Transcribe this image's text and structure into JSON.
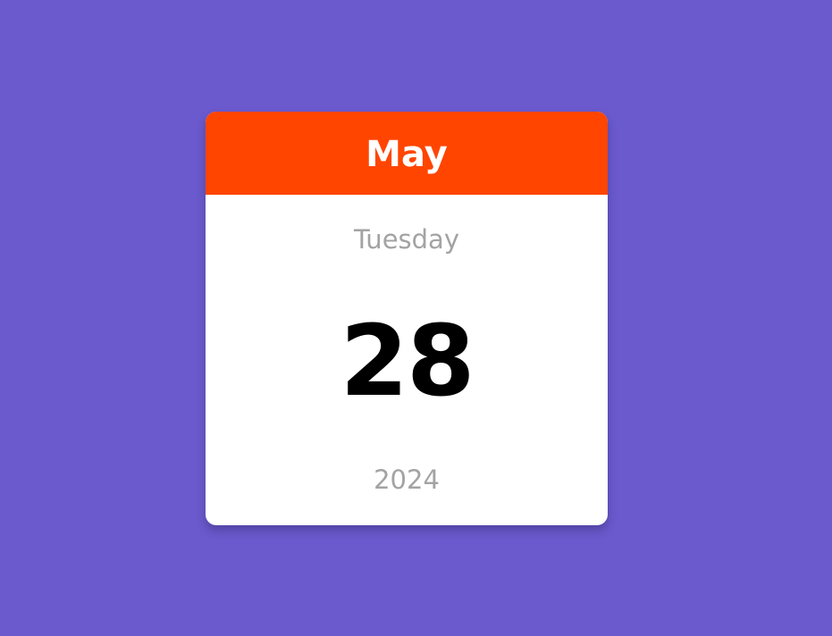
{
  "colors": {
    "page_background": "#6a5acd",
    "header_background": "#ff4500",
    "card_background": "#ffffff",
    "muted_text": "#a3a3a3",
    "day_text": "#000000"
  },
  "calendar": {
    "month": "May",
    "weekday": "Tuesday",
    "day": "28",
    "year": "2024"
  }
}
